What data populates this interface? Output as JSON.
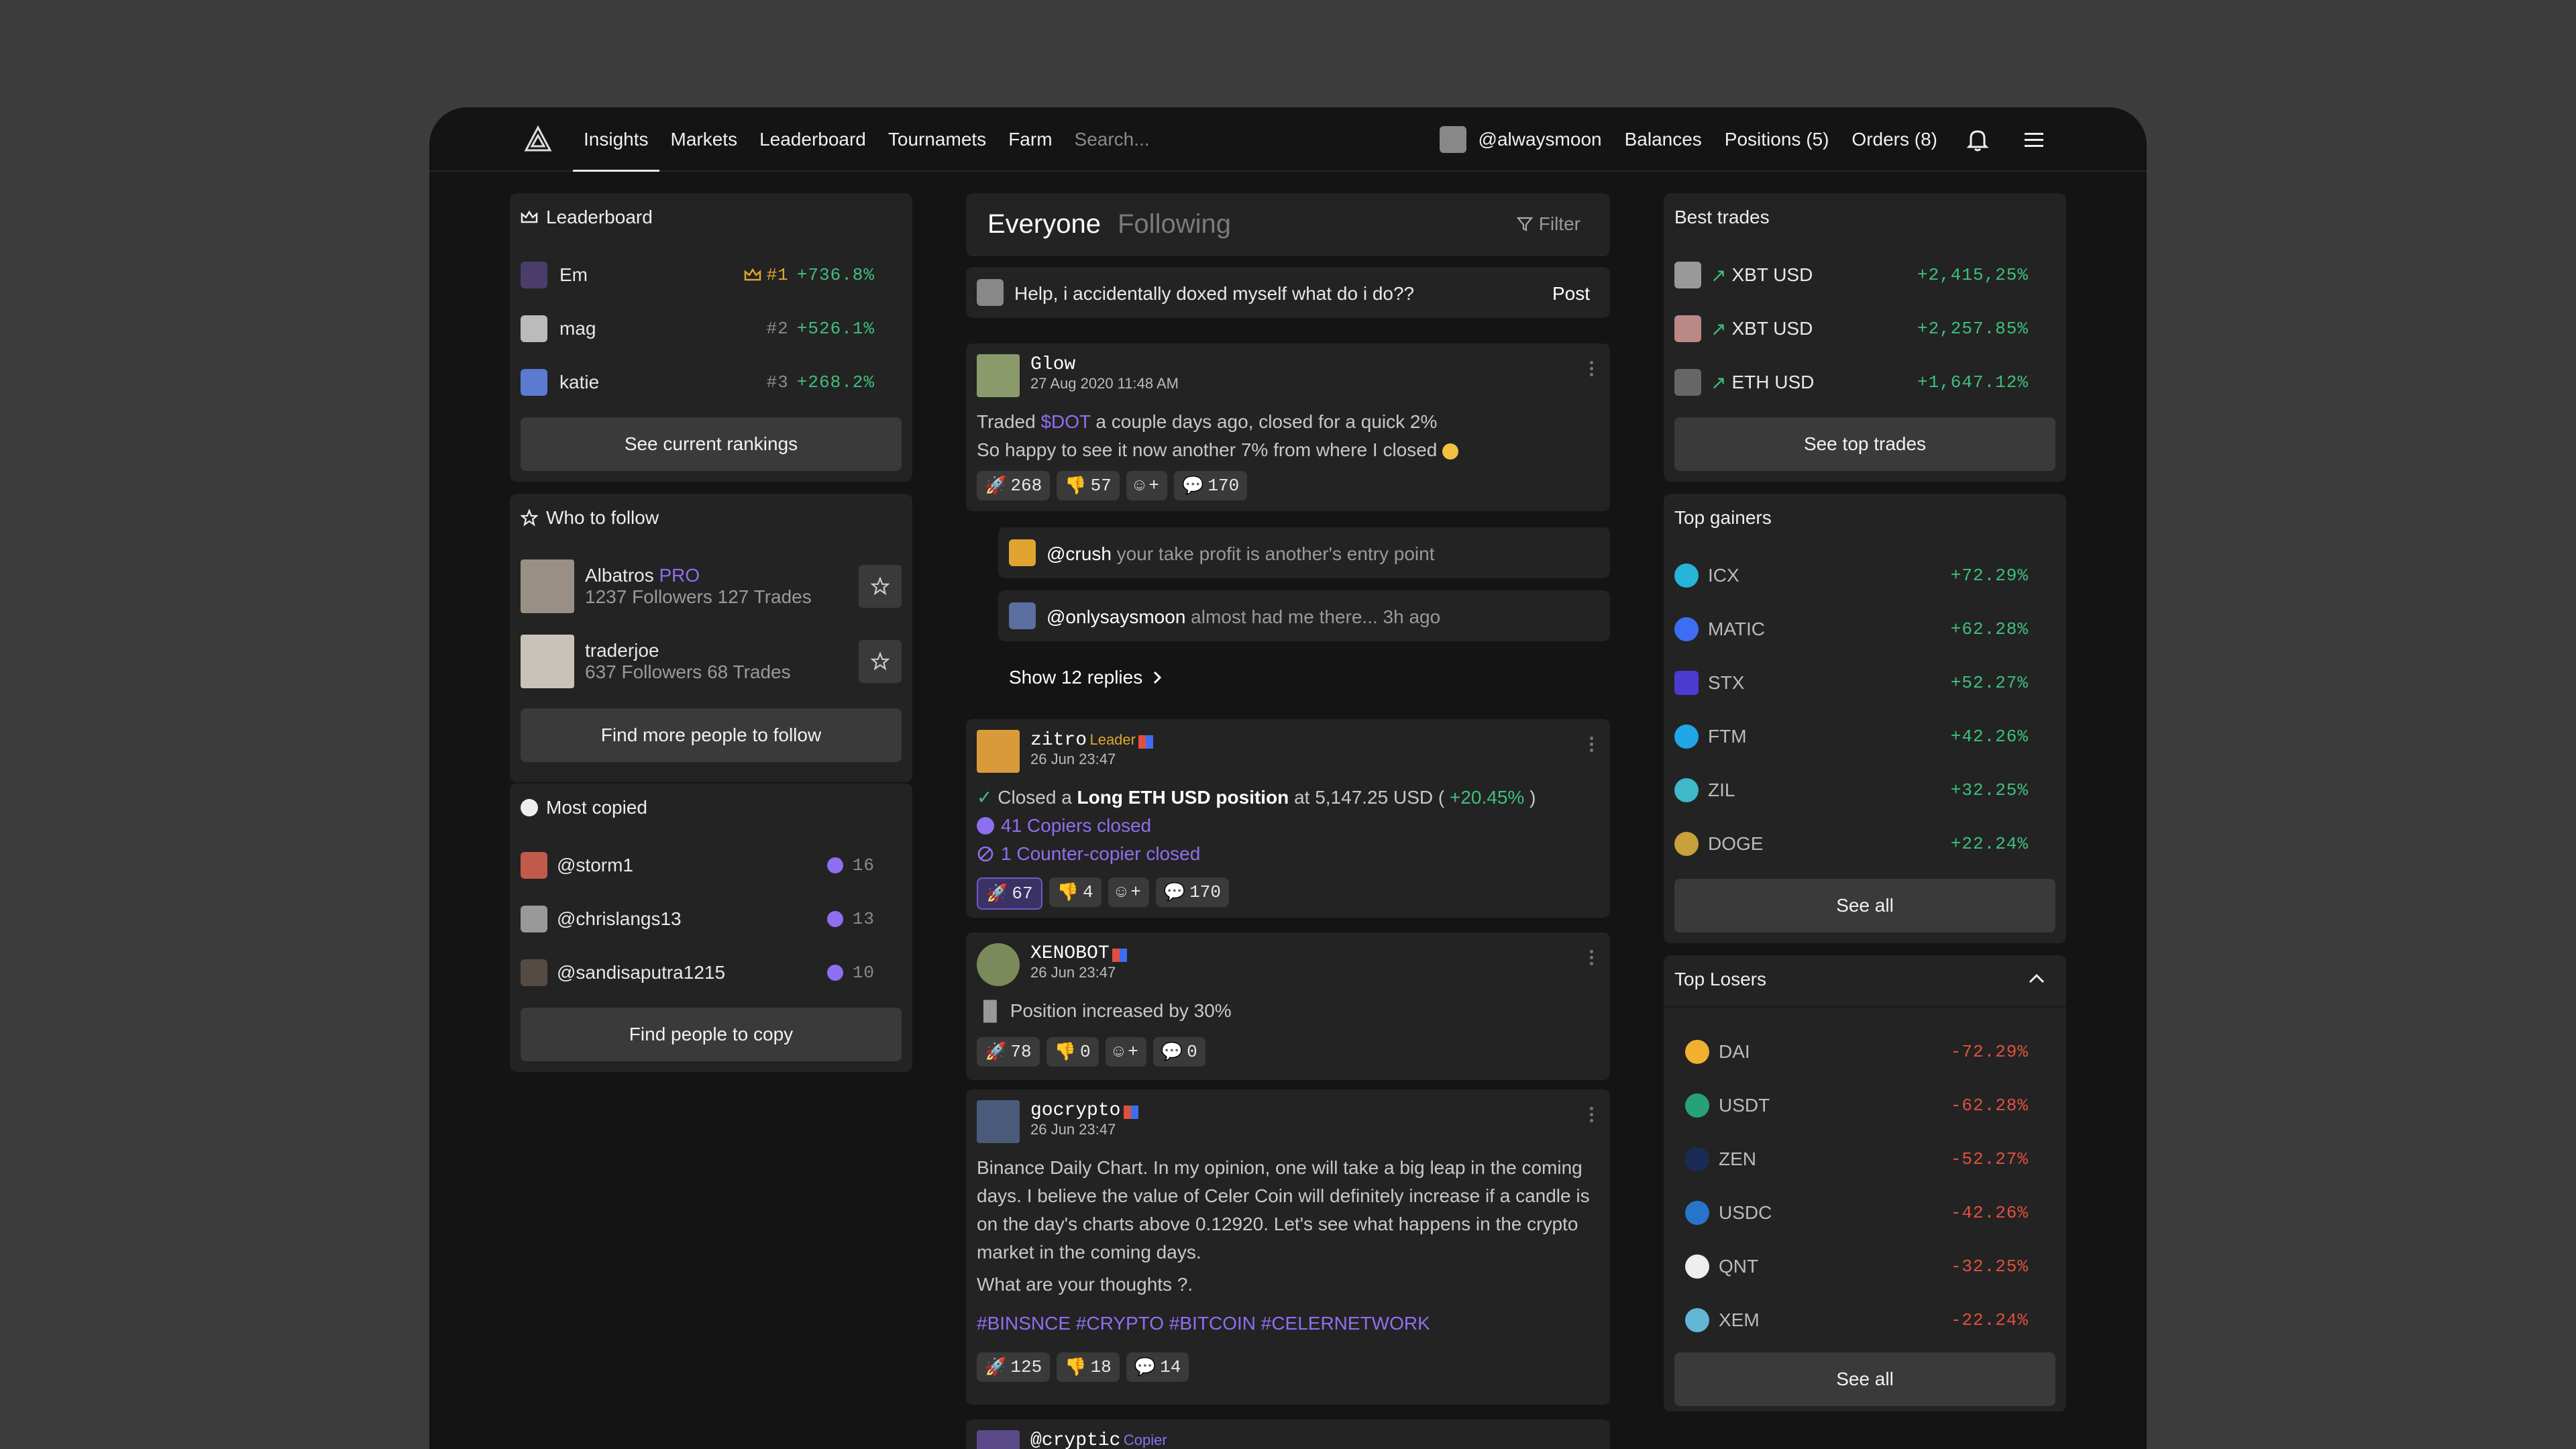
{
  "nav": {
    "links": [
      "Insights",
      "Markets",
      "Leaderboard",
      "Tournamets",
      "Farm"
    ],
    "search_placeholder": "Search...",
    "username": "@alwaysmoon",
    "balances": "Balances",
    "positions": "Positions (5)",
    "orders": "Orders (8)"
  },
  "leaderboard": {
    "title": "Leaderboard",
    "rows": [
      {
        "name": "Em",
        "rank": "#1",
        "pct": "+736.8%"
      },
      {
        "name": "mag",
        "rank": "#2",
        "pct": "+526.1%"
      },
      {
        "name": "katie",
        "rank": "#3",
        "pct": "+268.2%"
      }
    ],
    "button": "See current rankings"
  },
  "who_to_follow": {
    "title": "Who to follow",
    "people": [
      {
        "name": "Albatros",
        "badge": "PRO",
        "stats": "1237 Followers 127 Trades"
      },
      {
        "name": "traderjoe",
        "badge": "",
        "stats": "637 Followers 68 Trades"
      }
    ],
    "button": "Find more people to follow"
  },
  "most_copied": {
    "title": "Most copied",
    "rows": [
      {
        "name": "@storm1",
        "count": "16"
      },
      {
        "name": "@chrislangs13",
        "count": "13"
      },
      {
        "name": "@sandisaputra1215",
        "count": "10"
      }
    ],
    "button": "Find people to copy"
  },
  "feed": {
    "tab_everyone": "Everyone",
    "tab_following": "Following",
    "filter": "Filter",
    "compose_text": "Help, i accidentally doxed myself what do i do??",
    "post_button": "Post",
    "posts": [
      {
        "name": "Glow",
        "date": "27 Aug 2020 11:48 AM",
        "line1_pre": "Traded ",
        "ticker": "$DOT",
        "line1_post": " a couple days ago, closed for a quick 2%",
        "line2": "So happy to see it now another 7% from where I closed",
        "reactions": {
          "rocket": "268",
          "down": "57",
          "plus": "+",
          "comments": "170"
        }
      },
      {
        "name": "zitro",
        "tag": "Leader",
        "date": "26 Jun 23:47",
        "closed_pre": "Closed a ",
        "closed_pos": "Long ETH USD position",
        "closed_mid": " at 5,147.25 USD ( ",
        "closed_pct": "+20.45%",
        "closed_end": " )",
        "copiers": "41 Copiers closed",
        "counter": "1 Counter-copier closed",
        "reactions": {
          "rocket": "67",
          "down": "4",
          "plus": "+",
          "comments": "170"
        }
      },
      {
        "name": "XENOBOT",
        "date": "26 Jun 23:47",
        "increase": "Position increased by 30%",
        "reactions": {
          "rocket": "78",
          "down": "0",
          "plus": "+",
          "comments": "0"
        }
      },
      {
        "name": "gocrypto",
        "date": "26 Jun 23:47",
        "body": "Binance Daily Chart. In my opinion, one will take a big leap in the coming days. I believe the value of Celer Coin will definitely increase if a candle is on the day's charts above 0.12920. Let's see what happens in the crypto market in the coming days.",
        "question": "What are your thoughts ?.",
        "tags": "#BINSNCE #CRYPTO #BITCOIN #CELERNETWORK",
        "reactions": {
          "rocket": "125",
          "down": "18",
          "comments": "14"
        }
      },
      {
        "name": "@cryptic",
        "tag": "Copier"
      }
    ],
    "replies": [
      {
        "user": "@crush",
        "text": " your take profit is another's entry point"
      },
      {
        "user": "@onlysaysmoon",
        "text": " almost had me there... 3h ago"
      }
    ],
    "show_replies": "Show 12 replies"
  },
  "best_trades": {
    "title": "Best trades",
    "rows": [
      {
        "pair": "XBT USD",
        "pct": "+2,415,25%"
      },
      {
        "pair": "XBT USD",
        "pct": "+2,257.85%"
      },
      {
        "pair": "ETH USD",
        "pct": "+1,647.12%"
      }
    ],
    "button": "See top trades"
  },
  "top_gainers": {
    "title": "Top gainers",
    "rows": [
      {
        "coin": "ICX",
        "pct": "+72.29%",
        "color": "#27b4d8"
      },
      {
        "coin": "MATIC",
        "pct": "+62.28%",
        "color": "#3d6ef2"
      },
      {
        "coin": "STX",
        "pct": "+52.27%",
        "color": "#4c3bd1"
      },
      {
        "coin": "FTM",
        "pct": "+42.26%",
        "color": "#1fa7e8"
      },
      {
        "coin": "ZIL",
        "pct": "+32.25%",
        "color": "#3fb8c9"
      },
      {
        "coin": "DOGE",
        "pct": "+22.24%",
        "color": "#c9a13a"
      }
    ],
    "button": "See all"
  },
  "top_losers": {
    "title": "Top Losers",
    "rows": [
      {
        "coin": "DAI",
        "pct": "-72.29%",
        "color": "#f0b030"
      },
      {
        "coin": "USDT",
        "pct": "-62.28%",
        "color": "#27a17a"
      },
      {
        "coin": "ZEN",
        "pct": "-52.27%",
        "color": "#1a2c55"
      },
      {
        "coin": "USDC",
        "pct": "-42.26%",
        "color": "#2775ca"
      },
      {
        "coin": "QNT",
        "pct": "-32.25%",
        "color": "#eeeeee"
      },
      {
        "coin": "XEM",
        "pct": "-22.24%",
        "color": "#62b6d6"
      }
    ],
    "button": "See all"
  }
}
